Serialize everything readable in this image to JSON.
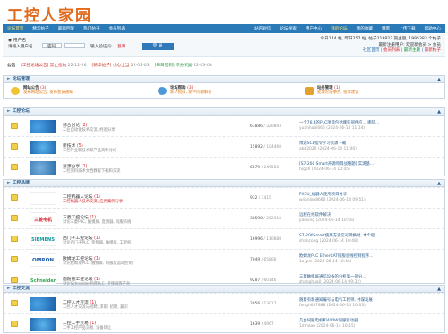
{
  "site": {
    "logo": "工控人家园"
  },
  "topnav": {
    "left": [
      "论坛首页",
      "精华帖子",
      "最新回复",
      "热门帖子",
      "会员列表"
    ],
    "right": [
      "站内短信",
      "论坛搜索",
      "用户中心",
      "我的论坛",
      "我的收藏",
      "博客",
      "上传下载",
      "帮助中心"
    ]
  },
  "userbar": {
    "tip": "用户名",
    "username_label": "请输入用户名",
    "password_label": "密码",
    "code_label": "输入验证码:",
    "code_value": "基库",
    "login_button": "登 录",
    "stats_line1": "今日144 帖, 昨日257 帖, 帖子219822 篇主题, 1995383 个帖子",
    "stats_line2": "最新注册用户: 欢迎新会员 > 会员",
    "link1": "社区首页",
    "link2": "会员列表",
    "link3": "最新主题",
    "link4": "最新帖子"
  },
  "notice": {
    "label": "公告",
    "items": [
      {
        "title": "[工控论坛公告] 禁止抢帖",
        "date": "22-12-26"
      },
      {
        "title": "[精华帖子] 小心上当",
        "date": "22-01-03"
      },
      {
        "title": "[每日签到] 积分奖励",
        "date": "22-03-08"
      }
    ]
  },
  "sections": [
    {
      "title": "论坛管理",
      "featured": [
        {
          "name": "网站公告",
          "count": "(3)",
          "sub": "发布网站公告, 发布会员通知"
        },
        {
          "name": "论坛帮助",
          "count": "(3)",
          "sub": "新人指南, 新手问题解答"
        },
        {
          "name": "站务管理",
          "count": "(1)",
          "sub": "处理论坛事务, 投诉建议"
        }
      ]
    },
    {
      "title": "工控论坛",
      "rows": [
        {
          "name": "综合讨论",
          "count": "(2)",
          "desc": "工业自动化技术交流, 经验分享",
          "topics": "63886",
          "posts": "/ 320893",
          "last_title": "一个76.4的PLC项目包括哪些部件应... 哪些...",
          "last_user": "yuanhuai666 (2024-06-14 11:14)",
          "thumb": "th-blue"
        },
        {
          "name": "新技术",
          "count": "(5)",
          "desc": "工控行业新技术新产品资料讨论",
          "topics": "15892",
          "posts": "/ 104460",
          "last_title": "博途SCL指令学习资源下载",
          "last_user": "abb2020 (2024-06-14 11:06)",
          "thumb": "th-blue2"
        },
        {
          "name": "资源分享",
          "count": "(1)",
          "desc": "工控资料技术文档教程下载和交流",
          "topics": "6879",
          "posts": "/ 249550",
          "last_title": "[S7-200 Smart开源项目战略题] 实现基...",
          "last_user": "fxgofi (2024-06-14 10:45)",
          "thumb": "th-gear"
        }
      ]
    },
    {
      "title": "工控品牌",
      "rows": [
        {
          "name": "工控机器人论坛",
          "count": "(1)",
          "desc": "工控机器人技术交流, 应用案例分享",
          "desc_red": true,
          "topics": "932",
          "posts": "/ 3415",
          "last_title": "FX5U_机器人使用项目分享",
          "last_user": "wjianlon8660 (2024-06-14 09:51)",
          "thumb": "th-b",
          "logo": ""
        },
        {
          "name": "三菱工控论坛",
          "count": "(1)",
          "desc": "讨论三菱PLC, 触摸屏, 变频器, 伺服系统",
          "topics": "38598",
          "posts": "/ 202910",
          "last_title": "远程在线软件解决",
          "last_user": "jiaoxing (2024-06-14 10:56)",
          "thumb": "th-mit",
          "logo": "三菱电机"
        },
        {
          "name": "西门子工控论坛",
          "count": "(1)",
          "desc": "讨论西门子PLC, 变频器, 触摸屏, 工控机",
          "topics": "16996",
          "posts": "/ 110888",
          "last_title": "S7-200Smart使用方波信号转换时, 本个程...",
          "last_user": "shancong (2024-06-14 10:48)",
          "thumb": "th-sie",
          "logo": "SIEMENS"
        },
        {
          "name": "欧姆龙工控论坛",
          "count": "(1)",
          "desc": "讨论欧姆龙PLC, 触摸屏, 伺服及运动控制",
          "topics": "7049",
          "posts": "/ 65866",
          "last_title": "欧姆龙PLC EtherCAT伺服总线控制程序...",
          "last_user": "1a_plc (2024-06-14 10:46)",
          "thumb": "th-omr",
          "logo": "OMRON"
        },
        {
          "name": "施耐德工控论坛",
          "count": "(1)",
          "desc": "讨论Schneider品牌PLC, 变频器等产品",
          "topics": "9287",
          "posts": "/ 60146",
          "last_title": "三菱触摸屏通信设备的分析第一部分...",
          "last_user": "zhanghua0 (2024-06-14 09:32)",
          "thumb": "th-b",
          "logo": "Schneider"
        }
      ]
    },
    {
      "title": "工控交流",
      "rows": [
        {
          "name": "工控人才交流",
          "count": "(1)",
          "desc": "工控人才交流与招聘, 求职, 招聘, 兼职",
          "topics": "2956",
          "posts": "/ 13017",
          "last_title": "随着有新通知编号与电气工程师, 共谋发展",
          "last_user": "fengh637888 (2024-06-14 10:03)",
          "thumb": "th-blue"
        },
        {
          "name": "工控二手交易",
          "count": "(1)",
          "desc": "二手工控产品交易, 设备转让",
          "topics": "1639",
          "posts": "/ 4967",
          "last_title": "几台伺服电机和400W伺服驱动器",
          "last_user": "1dmaan (2024-06-14 10:15)",
          "thumb": "th-blue2"
        }
      ]
    }
  ]
}
